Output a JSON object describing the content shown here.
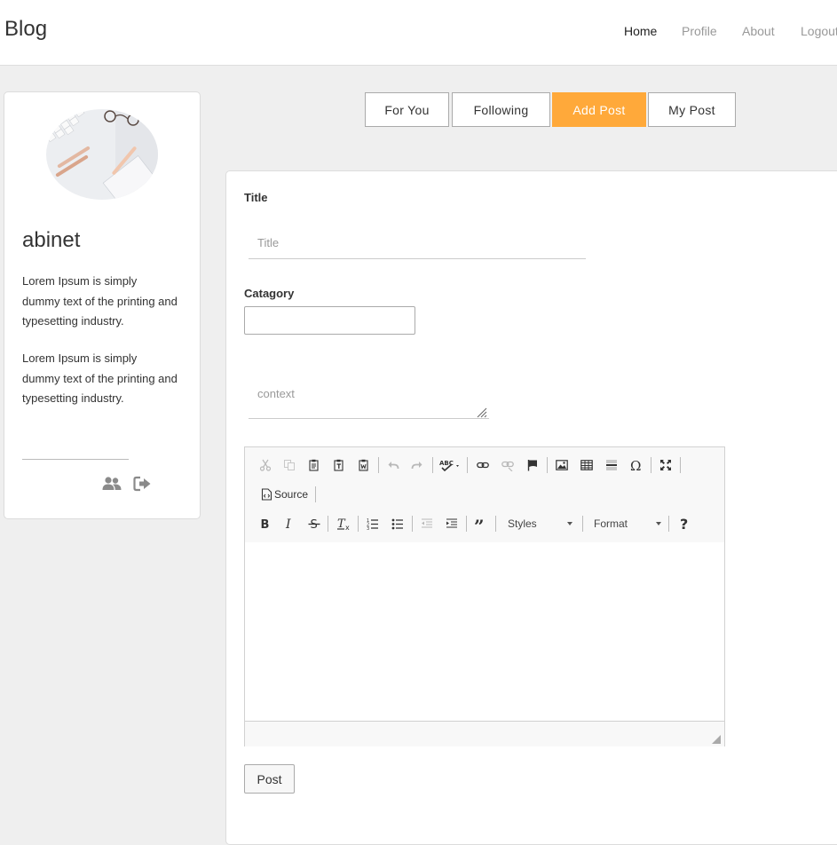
{
  "navbar": {
    "brand": "Blog",
    "links": [
      {
        "label": "Home",
        "active": true
      },
      {
        "label": "Profile",
        "active": false
      },
      {
        "label": "About",
        "active": false
      },
      {
        "label": "Logout",
        "active": false
      }
    ]
  },
  "profile": {
    "name": "abinet",
    "paragraphs": [
      "Lorem Ipsum is simply dummy text of the printing and typesetting industry.",
      "Lorem Ipsum is simply dummy text of the printing and typesetting industry."
    ],
    "icons": [
      "users-icon",
      "sign-out-icon"
    ]
  },
  "tabs": [
    {
      "label": "For You",
      "active": false
    },
    {
      "label": "Following",
      "active": false
    },
    {
      "label": "Add Post",
      "active": true
    },
    {
      "label": "My Post",
      "active": false
    }
  ],
  "form": {
    "title_label": "Title",
    "title_placeholder": "Title",
    "title_value": "",
    "category_label": "Catagory",
    "category_value": "",
    "context_placeholder": "context",
    "context_value": "",
    "editor": {
      "source_label": "Source",
      "styles_label": "Styles",
      "format_label": "Format",
      "content": ""
    },
    "submit_label": "Post"
  },
  "colors": {
    "accent": "#ffa93a",
    "background": "#efefef",
    "panel": "#ffffff"
  }
}
